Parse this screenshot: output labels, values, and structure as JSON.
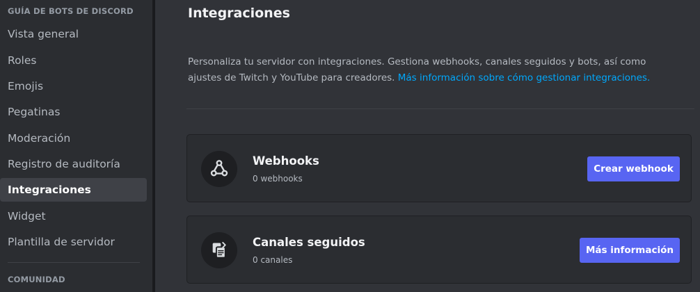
{
  "sidebar": {
    "heading_guide": "GUÍA DE BOTS DE DISCORD",
    "items": [
      {
        "label": "Vista general"
      },
      {
        "label": "Roles"
      },
      {
        "label": "Emojis"
      },
      {
        "label": "Pegatinas"
      },
      {
        "label": "Moderación"
      },
      {
        "label": "Registro de auditoría"
      },
      {
        "label": "Integraciones",
        "active": true
      },
      {
        "label": "Widget"
      },
      {
        "label": "Plantilla de servidor"
      }
    ],
    "heading_community": "COMUNIDAD"
  },
  "main": {
    "title": "Integraciones",
    "description": "Personaliza tu servidor con integraciones. Gestiona webhooks, canales seguidos y bots, así como ajustes de Twitch y YouTube para creadores.",
    "learn_more_link": "Más información sobre cómo gestionar integraciones."
  },
  "cards": {
    "webhooks": {
      "icon": "webhook-icon",
      "title": "Webhooks",
      "subtitle": "0 webhooks",
      "button": "Crear webhook"
    },
    "followed": {
      "icon": "followed-channel-icon",
      "title": "Canales seguidos",
      "subtitle": "0 canales",
      "button": "Más información"
    }
  },
  "colors": {
    "accent": "#5865f2",
    "link": "#00a8fc",
    "background": "#313338",
    "sidebar": "#2b2d31"
  }
}
